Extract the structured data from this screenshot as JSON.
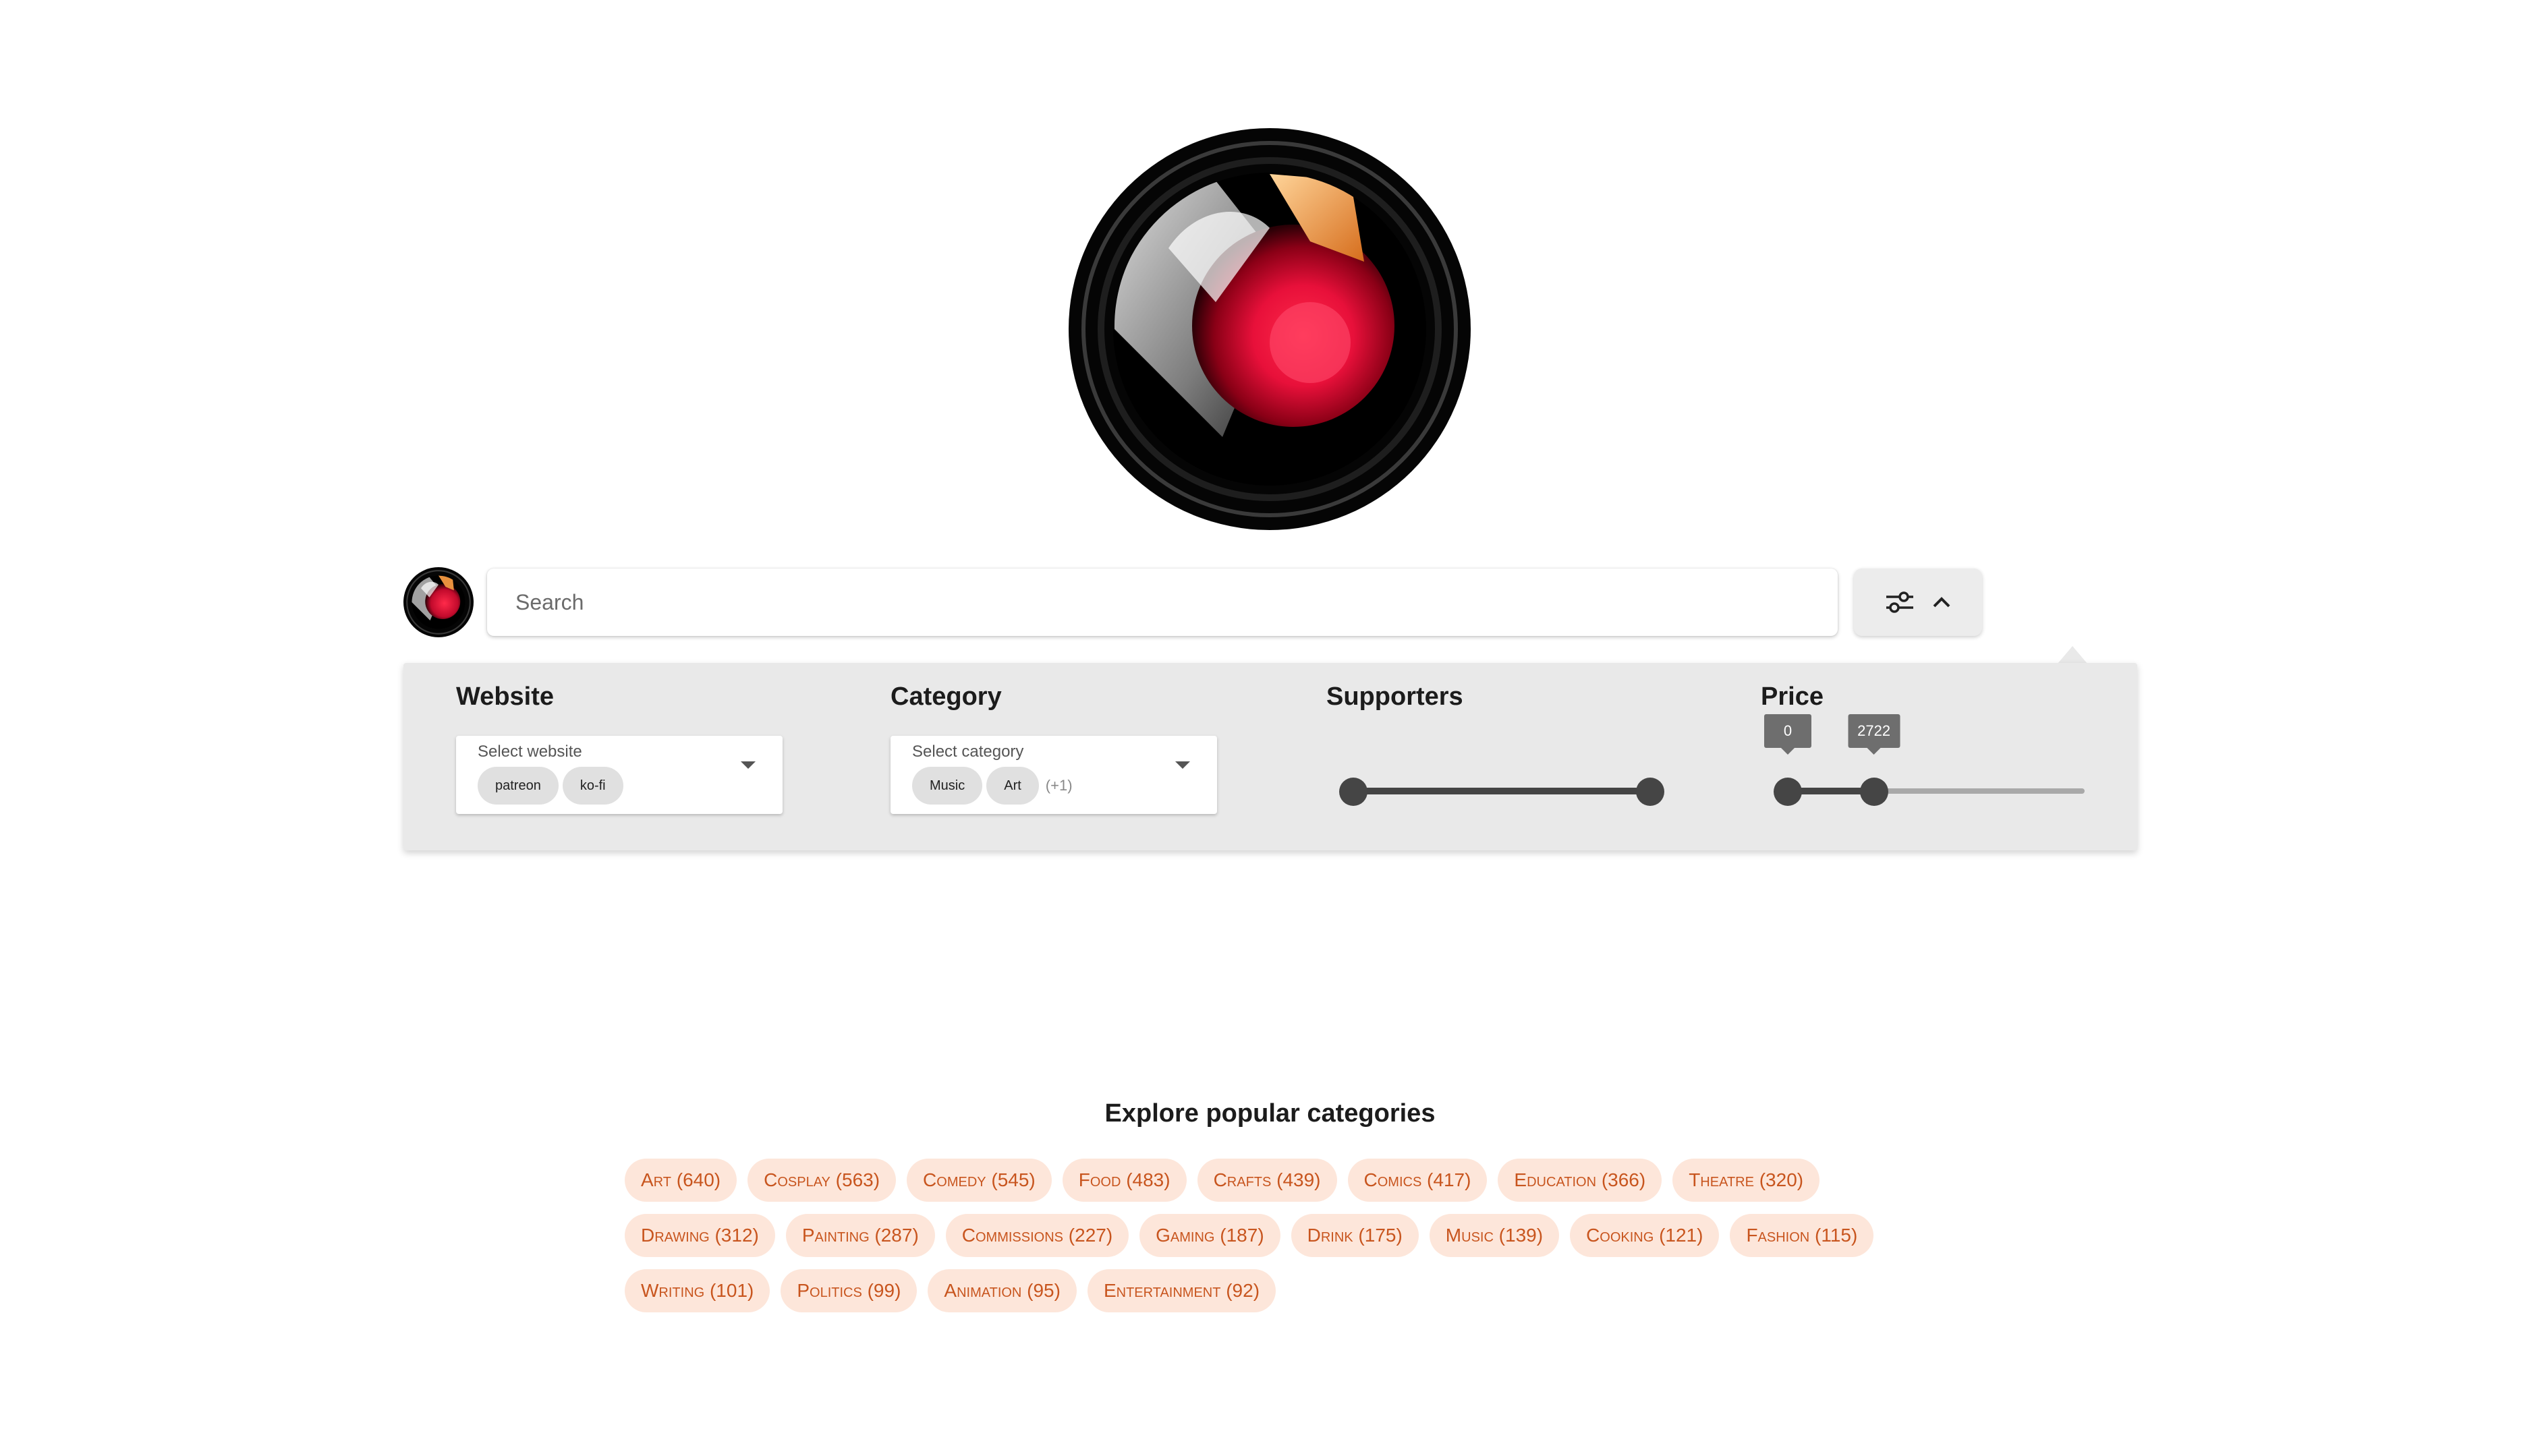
{
  "hero": {
    "logo_icon": "camera-lens-logo"
  },
  "header": {
    "mini_logo_icon": "camera-lens-logo",
    "search": {
      "placeholder": "Search",
      "value": ""
    },
    "filter_toggle": {
      "icons": [
        "sliders-icon",
        "chevron-up-icon"
      ]
    }
  },
  "filters": {
    "website": {
      "title": "Website",
      "placeholder": "Select website",
      "selected": [
        "patreon",
        "ko-fi"
      ]
    },
    "category": {
      "title": "Category",
      "placeholder": "Select category",
      "selected": [
        "Music",
        "Art"
      ],
      "more": "(+1)"
    },
    "supporters": {
      "title": "Supporters",
      "range": [
        0,
        1
      ],
      "low_fraction": 0.0,
      "high_fraction": 1.0
    },
    "price": {
      "title": "Price",
      "low_label": "0",
      "high_label": "2722",
      "low_fraction": 0.0,
      "high_fraction": 0.29
    }
  },
  "explore": {
    "title": "Explore popular categories",
    "categories": [
      "Art (640)",
      "Cosplay (563)",
      "Comedy (545)",
      "Food (483)",
      "Crafts (439)",
      "Comics (417)",
      "Education (366)",
      "Theatre (320)",
      "Drawing (312)",
      "Painting (287)",
      "Commissions (227)",
      "Gaming (187)",
      "Drink (175)",
      "Music (139)",
      "Cooking (121)",
      "Fashion (115)",
      "Writing (101)",
      "Politics (99)",
      "Animation (95)",
      "Entertainment (92)"
    ]
  },
  "colors": {
    "accent_text": "#c8551e",
    "chip_bg": "#fde6da",
    "panel_bg": "#e9e9e9",
    "slider": "#454545"
  }
}
